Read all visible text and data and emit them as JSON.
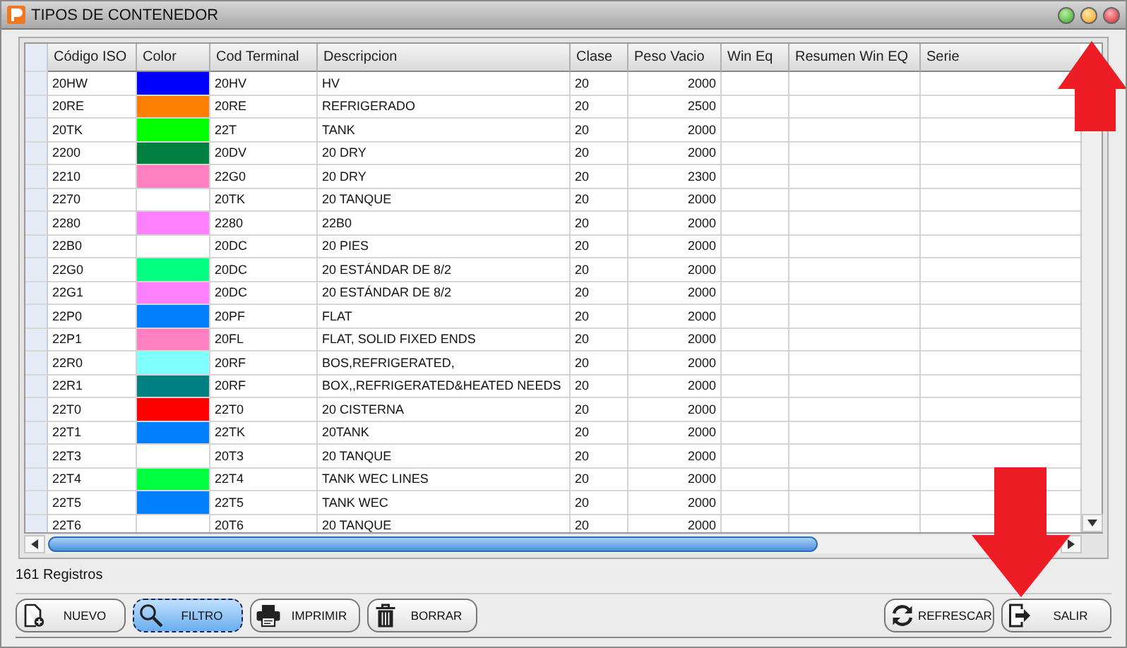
{
  "window": {
    "title": "TIPOS DE CONTENEDOR"
  },
  "table": {
    "columns": [
      "Código ISO",
      "Color",
      "Cod Terminal",
      "Descripcion",
      "Clase",
      "Peso Vacio",
      "Win Eq",
      "Resumen Win EQ",
      "Serie"
    ],
    "rows": [
      {
        "codigo_iso": "20HW",
        "color": "#0000ff",
        "cod_terminal": "20HV",
        "descripcion": "HV",
        "clase": "20",
        "peso_vacio": "2000"
      },
      {
        "codigo_iso": "20RE",
        "color": "#ff8000",
        "cod_terminal": "20RE",
        "descripcion": "REFRIGERADO",
        "clase": "20",
        "peso_vacio": "2500"
      },
      {
        "codigo_iso": "20TK",
        "color": "#00ff00",
        "cod_terminal": "22T",
        "descripcion": "TANK",
        "clase": "20",
        "peso_vacio": "2000"
      },
      {
        "codigo_iso": "2200",
        "color": "#008040",
        "cod_terminal": "20DV",
        "descripcion": "20 DRY",
        "clase": "20",
        "peso_vacio": "2000"
      },
      {
        "codigo_iso": "2210",
        "color": "#ff80c0",
        "cod_terminal": "22G0",
        "descripcion": "20 DRY",
        "clase": "20",
        "peso_vacio": "2300"
      },
      {
        "codigo_iso": "2270",
        "color": "#ffffff",
        "cod_terminal": "20TK",
        "descripcion": "20 TANQUE",
        "clase": "20",
        "peso_vacio": "2000"
      },
      {
        "codigo_iso": "2280",
        "color": "#ff80ff",
        "cod_terminal": "2280",
        "descripcion": "22B0",
        "clase": "20",
        "peso_vacio": "2000"
      },
      {
        "codigo_iso": "22B0",
        "color": "#ffffff",
        "cod_terminal": "20DC",
        "descripcion": "20 PIES",
        "clase": "20",
        "peso_vacio": "2000"
      },
      {
        "codigo_iso": "22G0",
        "color": "#00ff80",
        "cod_terminal": "20DC",
        "descripcion": "20 ESTÁNDAR DE 8/2",
        "clase": "20",
        "peso_vacio": "2000"
      },
      {
        "codigo_iso": "22G1",
        "color": "#ff80ff",
        "cod_terminal": "20DC",
        "descripcion": "20 ESTÁNDAR DE 8/2",
        "clase": "20",
        "peso_vacio": "2000"
      },
      {
        "codigo_iso": "22P0",
        "color": "#0080ff",
        "cod_terminal": "20PF",
        "descripcion": "FLAT",
        "clase": "20",
        "peso_vacio": "2000"
      },
      {
        "codigo_iso": "22P1",
        "color": "#ff80c0",
        "cod_terminal": "20FL",
        "descripcion": "FLAT, SOLID FIXED ENDS",
        "clase": "20",
        "peso_vacio": "2000"
      },
      {
        "codigo_iso": "22R0",
        "color": "#80ffff",
        "cod_terminal": "20RF",
        "descripcion": "BOS,REFRIGERATED,",
        "clase": "20",
        "peso_vacio": "2000"
      },
      {
        "codigo_iso": "22R1",
        "color": "#008080",
        "cod_terminal": "20RF",
        "descripcion": "BOX,,REFRIGERATED&HEATED NEEDS",
        "clase": "20",
        "peso_vacio": "2000"
      },
      {
        "codigo_iso": "22T0",
        "color": "#ff0000",
        "cod_terminal": "22T0",
        "descripcion": "20 CISTERNA",
        "clase": "20",
        "peso_vacio": "2000"
      },
      {
        "codigo_iso": "22T1",
        "color": "#0080ff",
        "cod_terminal": "22TK",
        "descripcion": "20TANK",
        "clase": "20",
        "peso_vacio": "2000"
      },
      {
        "codigo_iso": "22T3",
        "color": "#ffffff",
        "cod_terminal": "20T3",
        "descripcion": "20 TANQUE",
        "clase": "20",
        "peso_vacio": "2000"
      },
      {
        "codigo_iso": "22T4",
        "color": "#00ff40",
        "cod_terminal": "22T4",
        "descripcion": "TANK WEC LINES",
        "clase": "20",
        "peso_vacio": "2000"
      },
      {
        "codigo_iso": "22T5",
        "color": "#0080ff",
        "cod_terminal": "22T5",
        "descripcion": "TANK WEC",
        "clase": "20",
        "peso_vacio": "2000"
      },
      {
        "codigo_iso": "22T6",
        "color": "#ffffff",
        "cod_terminal": "20T6",
        "descripcion": "20 TANQUE",
        "clase": "20",
        "peso_vacio": "2000"
      }
    ]
  },
  "status_bar": {
    "count": "161 Registros"
  },
  "left_buttons": [
    {
      "label": "NUEVO",
      "kind": "new",
      "selected": false
    },
    {
      "label": "FILTRO",
      "kind": "filter",
      "selected": true
    },
    {
      "label": "IMPRIMIR",
      "kind": "print",
      "selected": false
    },
    {
      "label": "BORRAR",
      "kind": "delete",
      "selected": false
    }
  ],
  "right_buttons": [
    {
      "label": "REFRESCAR",
      "kind": "refresh",
      "selected": false
    },
    {
      "label": "SALIR",
      "kind": "exit",
      "selected": false
    }
  ]
}
